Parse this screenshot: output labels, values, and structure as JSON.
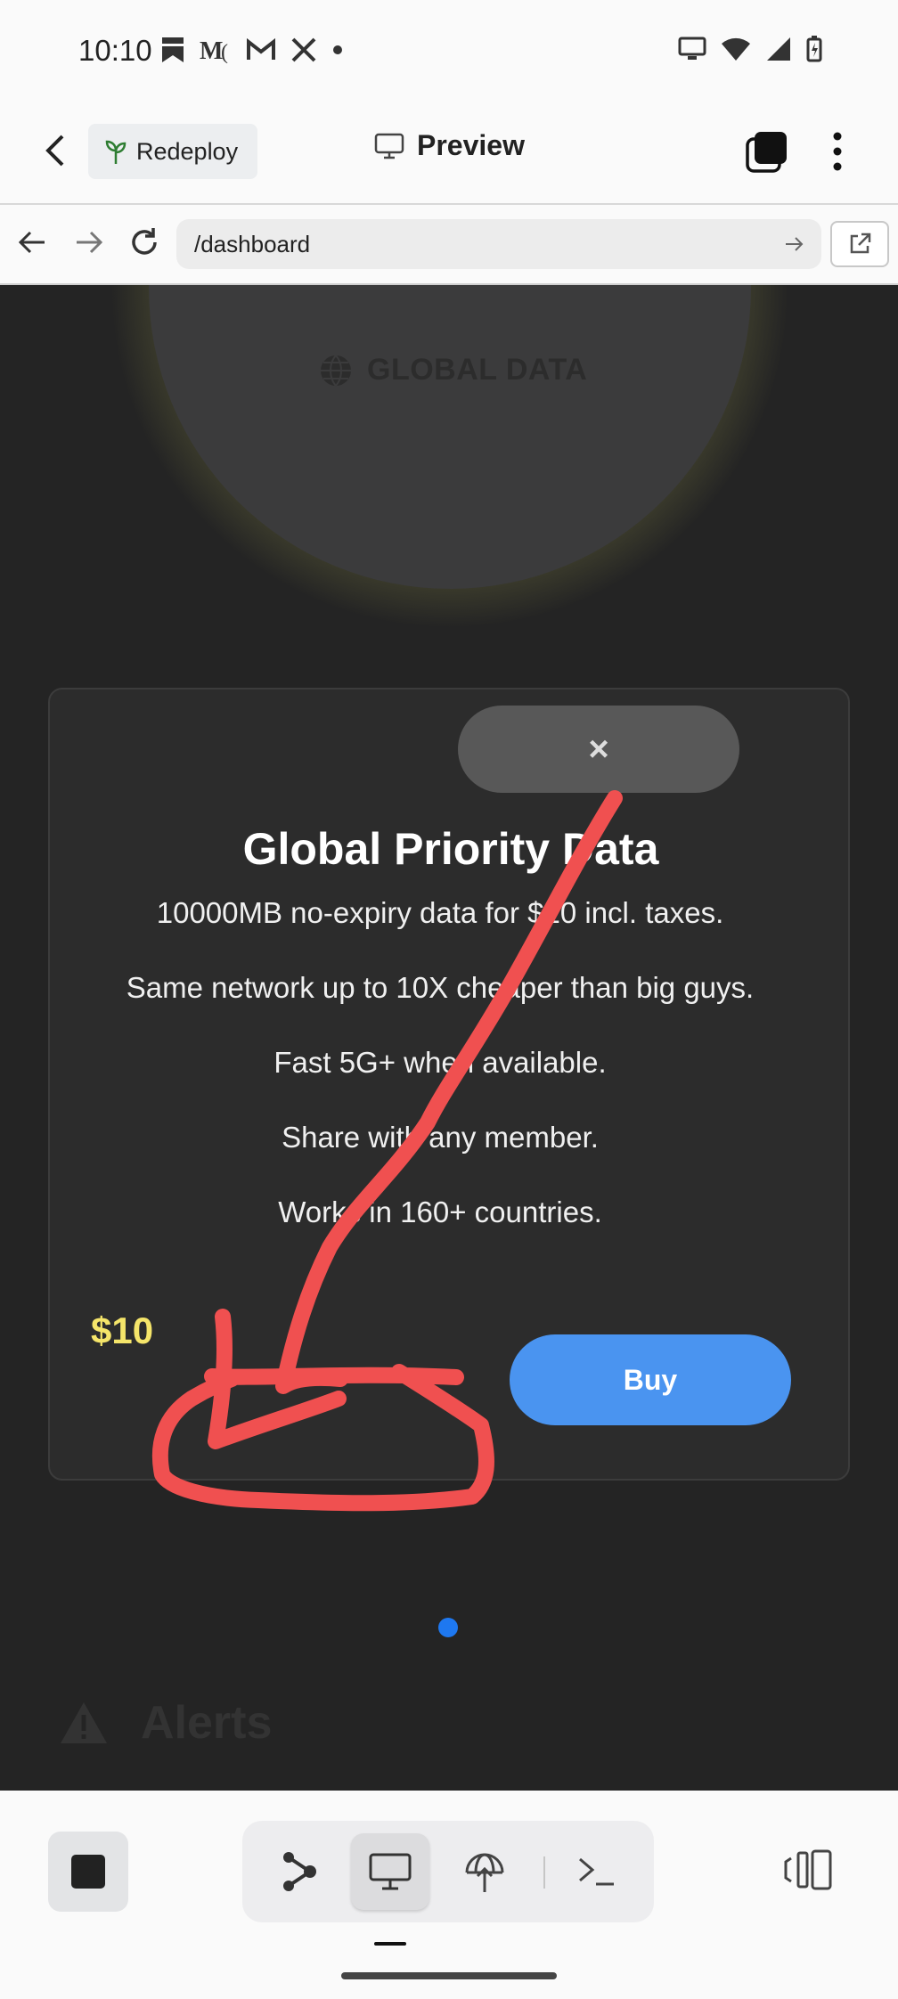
{
  "status_bar": {
    "time": "10:10",
    "notification_icons": [
      "bookmark-icon",
      "medium-icon",
      "gmail-icon",
      "x-icon",
      "dot-icon"
    ],
    "system_icons": [
      "cast-icon",
      "wifi-icon",
      "signal-icon",
      "battery-charging-icon"
    ]
  },
  "app_bar": {
    "redeploy_label": "Redeploy",
    "title": "Preview"
  },
  "browser": {
    "url": "/dashboard"
  },
  "page": {
    "global_data_label": "GLOBAL DATA",
    "modal": {
      "close_symbol": "×",
      "title": "Global Priority Data",
      "lines": [
        "10000MB no-expiry data for $10 incl. taxes.",
        "Same network up to 10X cheaper than big guys.",
        "Fast 5G+ when available.",
        "Share with any member.",
        "Works in 160+ countries."
      ],
      "price": "$10",
      "buy_label": "Buy"
    },
    "alerts_title": "Alerts"
  },
  "bottom_toolbar": {
    "tools": [
      "graph-icon",
      "desktop-icon",
      "deploy-icon",
      "terminal-icon"
    ],
    "active_tool": "desktop-icon"
  },
  "colors": {
    "accent_blue": "#4a94f0",
    "price_yellow": "#f5e56a",
    "scribble_red": "#f05050",
    "page_bg": "#242424"
  }
}
